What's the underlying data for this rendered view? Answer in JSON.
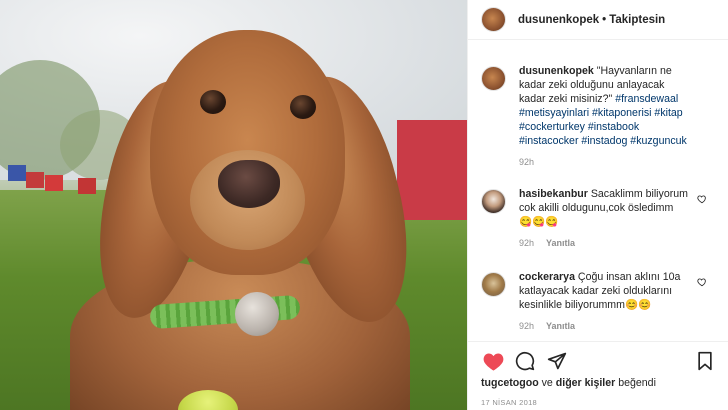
{
  "post": {
    "author": "dusunenkopek",
    "follow_separator": "•",
    "follow_label": "Takiptesin",
    "caption_user": "dusunenkopek",
    "caption_text": "\"Hayvanların ne kadar zeki olduğunu anlayacak kadar zeki misiniz?\"",
    "caption_tags": "#fransdewaal #metisyayinlari #kitaponerisi #kitap #cockerturkey #instabook #instacocker #instadog #kuzguncuk",
    "caption_time": "92h"
  },
  "comments": [
    {
      "user": "hasibekanbur",
      "text": "Sacaklimm biliyorum cok akilli oldugunu,cok ösledimm 😋😋😋",
      "time": "92h",
      "reply": "Yanıtla"
    },
    {
      "user": "cockerarya",
      "text": "Çoğu insan aklını 10a katlayacak kadar zeki olduklarını kesinlikle biliyorummm😊😊",
      "time": "92h",
      "reply": "Yanıtla"
    }
  ],
  "footer": {
    "liked_by_user": "tugcetogoo",
    "liked_connector": "ve",
    "liked_others": "diğer kişiler",
    "liked_suffix": "beğendi",
    "date": "17 NİSAN 2018"
  },
  "icons": [
    "heart-filled-icon",
    "comment-icon",
    "share-icon",
    "bookmark-icon",
    "heart-outline-icon"
  ],
  "colors": {
    "like_red": "#ed4956",
    "hashtag_blue": "#00376b",
    "muted": "#8e8e8e"
  }
}
